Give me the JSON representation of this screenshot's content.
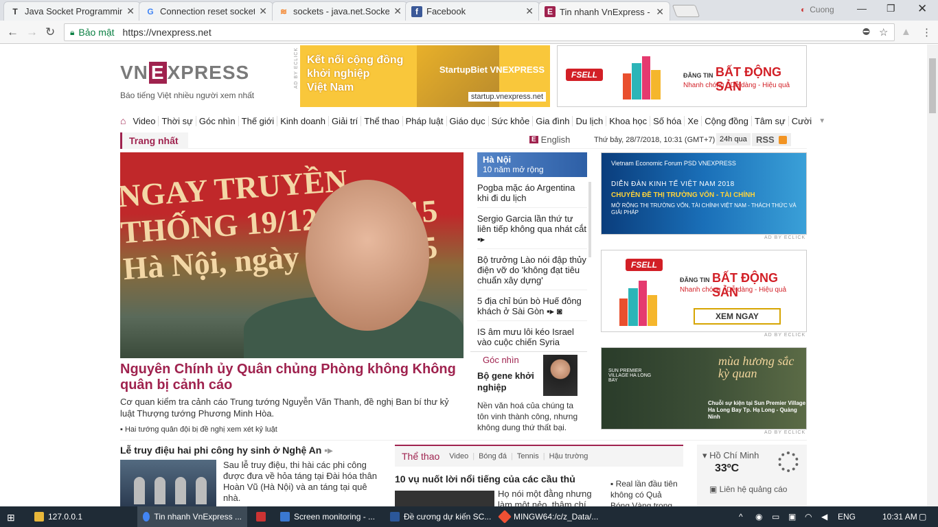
{
  "browser": {
    "tabs": [
      {
        "title": "Java Socket Programming",
        "icon": "T",
        "active": false
      },
      {
        "title": "Connection reset socket",
        "icon": "G",
        "active": false
      },
      {
        "title": "sockets - java.net.SocketE",
        "icon": "stack-icon",
        "active": false
      },
      {
        "title": "Facebook",
        "icon": "f",
        "active": false
      },
      {
        "title": "Tin nhanh VnExpress - Đọ",
        "icon": "E",
        "active": true
      }
    ],
    "user": "Cuong",
    "secure_label": "Bảo mật",
    "url": "https://vnexpress.net"
  },
  "site": {
    "logo": "VNEXPRESS",
    "slogan": "Báo tiếng Việt nhiều người xem nhất",
    "menu": [
      "Video",
      "Thời sự",
      "Góc nhìn",
      "Thế giới",
      "Kinh doanh",
      "Giải trí",
      "Thể thao",
      "Pháp luật",
      "Giáo dục",
      "Sức khỏe",
      "Gia đình",
      "Du lịch",
      "Khoa học",
      "Số hóa",
      "Xe",
      "Cộng đồng",
      "Tâm sự",
      "Cười"
    ],
    "section": "Trang nhất",
    "english": "English",
    "date": "Thứ bảy, 28/7/2018, 10:31 (GMT+7)",
    "h24": "24h qua",
    "rss": "RSS"
  },
  "ads": {
    "adby": "AD BY ECLICK",
    "startup": {
      "line1": "Kết nối cộng đồng",
      "line2": "khởi nghiệp",
      "line3": "Việt Nam",
      "brand": "StartupBiet VNEXPRESS",
      "url": "startup.vnexpress.net"
    },
    "fsell": {
      "brand": "FSELL",
      "dang": "ĐĂNG TIN",
      "title": "BẤT ĐỘNG SẢN",
      "sub": "Nhanh chóng - Dễ dàng - Hiệu quả",
      "button": "XEM NGAY"
    },
    "forum": {
      "head": "Vietnam Economic Forum  PSD  VNEXPRESS",
      "t1": "DIỄN ĐÀN KINH TẾ VIỆT NAM 2018",
      "t2": "CHUYÊN ĐỀ THỊ TRƯỜNG VỐN - TÀI CHÍNH",
      "t3": "MỞ RỘNG THỊ TRƯỜNG VỐN, TÀI CHÍNH VIỆT NAM - THÁCH THỨC VÀ GIẢI PHÁP"
    },
    "premier": {
      "brand": "SUN PREMIER VILLAGE HA LONG BAY",
      "title": "mùa hương sắc kỳ quan",
      "sub": "Chuỗi sự kiện tại Sun Premier Village Ha Long Bay Tp. Hạ Long - Quảng Ninh"
    }
  },
  "hero": {
    "banner": "NGAY TRUYỀN THỐNG 19/12/19 /2015 Hà Nội, ngày năm 2015",
    "headline": "Nguyên Chính ủy Quân chủng Phòng không Không quân bị cảnh cáo",
    "lead": "Cơ quan kiểm tra cảnh cáo Trung tướng Nguyễn Văn Thanh, đề nghị Ban bí thư kỷ luật Thượng tướng Phương Minh Hòa.",
    "related": "Hai tướng quân đội bị đề nghị xem xét kỷ luật"
  },
  "col2": {
    "hanoi_title": "Hà Nội",
    "hanoi_sub": "10 năm mở rộng",
    "news": [
      "Pogba mặc áo Argentina khi đi du lịch",
      "Sergio Garcia lần thứ tư liên tiếp không qua nhát cắt",
      "Bộ trưởng Lào nói đập thủy điện vỡ do 'không đạt tiêu chuẩn xây dựng'",
      "5 địa chỉ bún bò Huế đông khách ở Sài Gòn",
      "IS âm mưu lôi kéo Israel vào cuộc chiến Syria"
    ],
    "goc_title": "Góc nhìn",
    "goc_head": "Bộ gene khởi nghiệp",
    "goc_desc": "Nền văn hoá của chúng ta tôn vinh thành công, nhưng không dung thứ thất bại."
  },
  "lower": {
    "story_title": "Lễ truy điệu hai phi công hy sinh ở Nghệ An",
    "story_lead": "Sau lễ truy điệu, thi hài các phi công được đưa về hỏa táng tại Đài hóa thân Hoàn Vũ (Hà Nội) và an táng tại quê nhà.",
    "sport_main": "Thể thao",
    "sport_subs": [
      "Video",
      "Bóng đá",
      "Tennis",
      "Hậu trường"
    ],
    "sport_head": "10 vụ nuốt lời nổi tiếng của các cầu thủ",
    "sport_lead": "Họ nói một đằng nhưng làm một nẻo, thậm chí",
    "real": "Real lần đầu tiên không có Quả Bóng Vàng trong",
    "weather_city": "Hồ Chí Minh",
    "weather_temp": "33ºC",
    "contact": "Liên hệ quảng cáo"
  },
  "taskbar": {
    "items": [
      "127.0.0.1",
      "Tin nhanh VnExpress ...",
      "",
      "Screen monitoring - ...",
      "Đề cương dự kiến SC...",
      "MINGW64:/c/z_Data/..."
    ],
    "lang": "ENG",
    "time": "10:31 AM"
  }
}
